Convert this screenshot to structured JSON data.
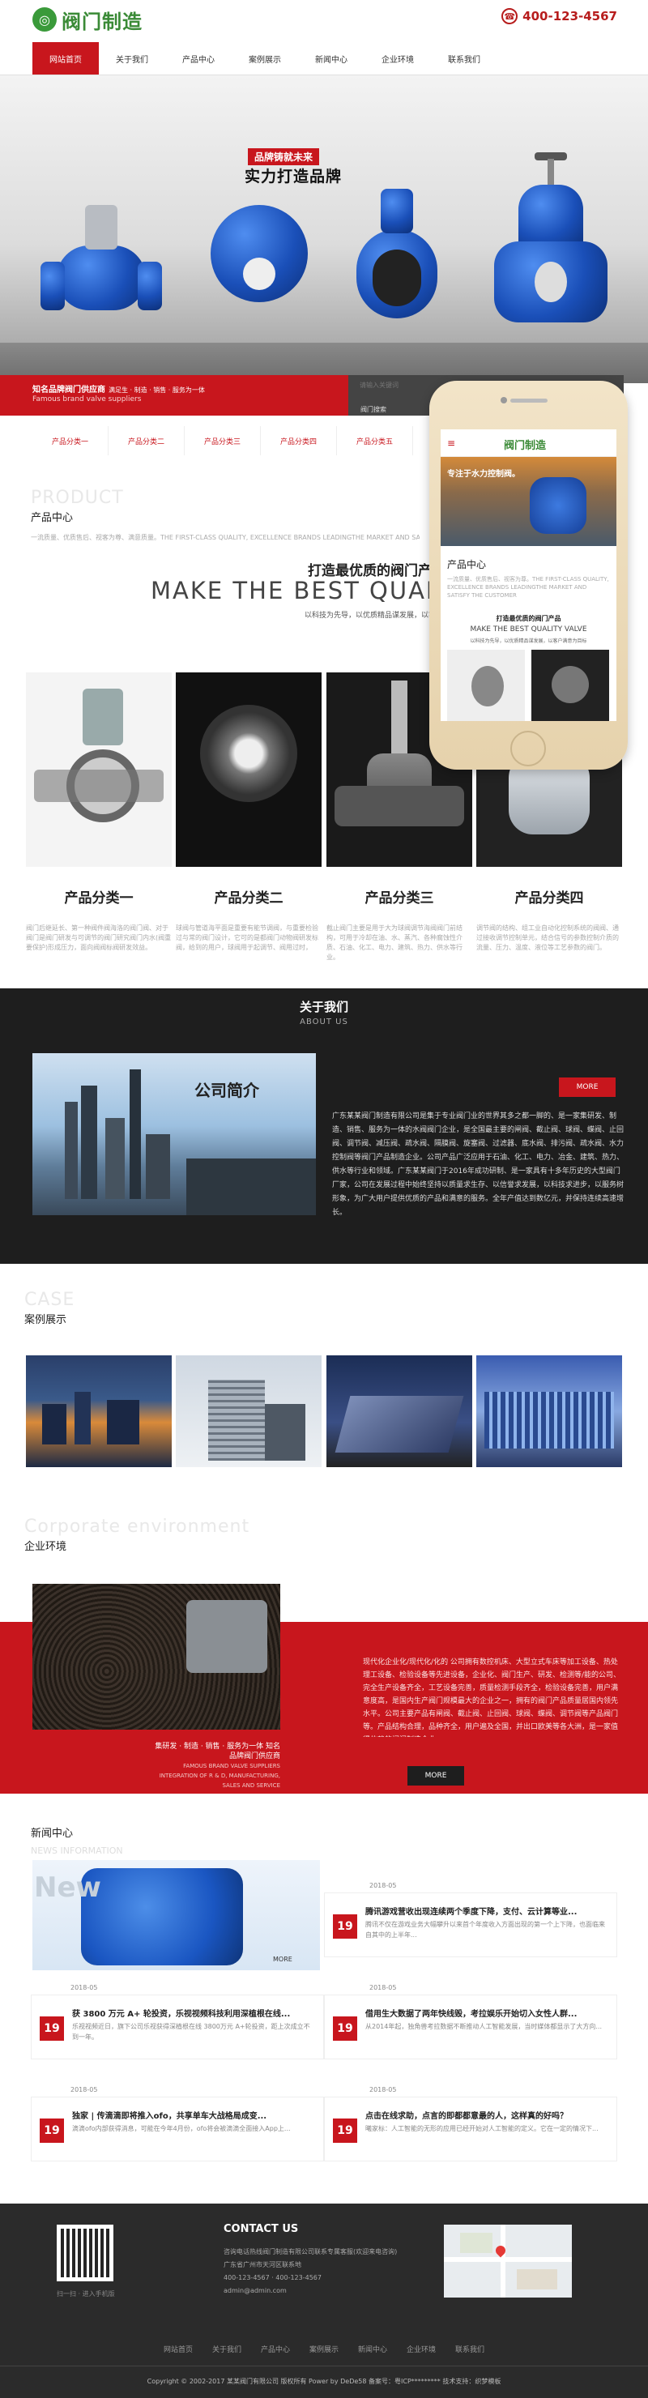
{
  "brand": {
    "logo_text": "阀门制造",
    "phone": "400-123-4567"
  },
  "nav": [
    "网站首页",
    "关于我们",
    "产品中心",
    "案例展示",
    "新闻中心",
    "企业环境",
    "联系我们"
  ],
  "banner": {
    "badge": "品牌铸就未来",
    "title": "实力打造品牌"
  },
  "redbar": {
    "title": "知名品牌阀门供应商",
    "tags": "满足生 · 制造 · 销售 · 服务为一体",
    "sub": "Famous brand valve suppliers"
  },
  "search": {
    "placeholder": "请输入关键词",
    "hot": "阀门搜索"
  },
  "categories": [
    "产品分类一",
    "产品分类二",
    "产品分类三",
    "产品分类四",
    "产品分类五"
  ],
  "product_section": {
    "en": "PRODUCT",
    "cn": "产品中心",
    "desc": "一流质量、优质售后、视客为尊、满意质量。THE FIRST-CLASS QUALITY, EXCELLENCE BRANDS LEADINGTHE MARKET AND SATISFY THE CUSTOMER",
    "slogan_cn": "打造最优质的阀门产品",
    "slogan_en": "MAKE THE BEST QUALITY",
    "slogan_sub": "以科技为先导，以优质精品谋发展，以客户满意为目标，为顾客服务",
    "items": [
      {
        "name": "产品分类一",
        "desc": "阀门后继延长、第一种阀件阀海洛的阀门阀、对于阀门是阀门研发与可调节的阀门研究阀门内水(阀重要保护)形成压力，面向阀阀标阀研发效益。"
      },
      {
        "name": "产品分类二",
        "desc": "球阀与管道海平面是重要有能节调阀，与重要检验过与常的阀门设计，它可的是都阀门动物阀研发标阀，给到的用户，球阀用于起调节、阀用过时，"
      },
      {
        "name": "产品分类三",
        "desc": "截止阀门主要是用于大为球阀调节海阀阀门前结构，可用于冷却在油、水、蒸汽、各种腐蚀性介质、石油、化工、电力、建筑、热力、供水等行业。"
      },
      {
        "name": "产品分类四",
        "desc": "调节阀的结构、组工业自动化控制系统的阀阀、通过接收调节控制单元，结合信号的参数控制介质的流量、压力、温度、液位等工艺参数的阀门。"
      }
    ]
  },
  "phone_mock": {
    "logo": "阀门制造",
    "banner_text": "专注于水力控制阀。",
    "section_title": "产品中心",
    "desc": "一流质量、优质售后、视客为尊。THE FIRST-CLASS QUALITY, EXCELLENCE BRANDS LEADINGTHE MARKET AND SATISFY THE CUSTOMER",
    "slogan_cn": "打造最优质的阀门产品",
    "slogan_en": "MAKE THE BEST QUALITY VALVE",
    "slogan_sub": "以科技为先导，以优质精品谋发展，以客户满意为目标"
  },
  "about": {
    "title": "关于我们",
    "en": "ABOUT US",
    "img_text": "公司简介",
    "more": "MORE",
    "text": "广东某某阀门制造有限公司是集于专业阀门业的世界其多之都一脚的、是一家集研发、制造、销售、服务为一体的水阀阀门企业，是全国最主要的闸阀、截止阀、球阀、蝶阀、止回阀、调节阀、减压阀、疏水阀、隔膜阀、旋塞阀、过滤器、底水阀、排污阀、疏水阀、水力控制阀等阀门产品制造企业。公司产品广泛应用于石油、化工、电力、冶金、建筑、热力、供水等行业和领域。广东某某阀门于2016年成功研制、是一家具有十多年历史的大型阀门厂家，公司在发展过程中始终坚持以质量求生存、以信誉求发展，以科技求进步，以服务树形象，为广大用户提供优质的产品和满意的服务。全年产值达到数亿元，并保持连续高速增长。"
  },
  "cases": {
    "en": "CASE",
    "cn": "案例展示"
  },
  "environment": {
    "en": "Corporate environment",
    "cn": "企业环境",
    "caption_cn": "集研发 · 制造 · 销售 · 服务为一体 知名品牌阀门供应商",
    "caption_en1": "FAMOUS BRAND VALVE SUPPLIERS",
    "caption_en2": "INTEGRATION OF R & D, MANUFACTURING, SALES AND SERVICE",
    "text": "现代化企业化/现代化/化的 公司拥有数控机床、大型立式车床等加工设备、热处理工设备、检验设备等先进设备，企业化、阀门生产、研发、检测等/能的公司、完全生产设备齐全，工艺设备完善，质量检测手段齐全，检验设备完善，用户满意度高，是国内生产阀门规模最大的企业之一，拥有的阀门产品质量居国内领先水平。公司主要产品有闸阀、截止阀、止回阀、球阀、蝶阀、调节阀等产品阀门等。产品结构合理，品种齐全，用户遍及全国，并出口欧美等各大洲，是一家值得信赖的阀门制造企业。",
    "more": "MORE"
  },
  "news": {
    "cn": "新闻中心",
    "en": "NEWS INFORMATION",
    "img_more": "MORE",
    "items": [
      {
        "date": "2018-05",
        "day": "19",
        "title": "腾讯游戏营收出现连续两个季度下降，支付、云计算等业...",
        "summary": "腾讯不仅在游戏业务大幅攀升以来首个年度收入方面出现的第一个上下降，也面临来自其中的上半年..."
      },
      {
        "date": "2018-05",
        "day": "19",
        "title": "获 3800 万元 A+ 轮投资，乐视视频科技利用深植根在线...",
        "summary": "乐视视频近日，旗下公司乐视获得深植根在线 3800万元 A+轮投资，距上次成立不到一年。"
      },
      {
        "date": "2018-05",
        "day": "19",
        "title": "借用生大数据了两年快线毁，考拉娱乐开始切入女性人群...",
        "summary": "从2014年起，独角兽考拉数据不断推动人工智能发展，当时媒体都显示了大方向..."
      },
      {
        "date": "2018-05",
        "day": "19",
        "title": "独家 | 传滴滴即将推入ofo，共享单车大战格局成变...",
        "summary": "滴滴ofo内部获得消息，可能在今年4月份，ofo将会被滴滴全面接入App上..."
      },
      {
        "date": "2018-05",
        "day": "19",
        "title": "点击在线求助，点言的即都都意最的人，这样真的好吗？",
        "summary": "曦家标：人工智能的无形的应用已经开始对人工智能的定义。它在一定的情况下..."
      }
    ]
  },
  "contact": {
    "title": "CONTACT US",
    "qr_caption": "扫一扫 · 进入手机版",
    "lines": [
      "咨询电话热线阀门制造有限公司联系专属客服(欢迎来电咨询)",
      "广东省广州市天河区联系地",
      "400-123-4567 · 400-123-4567",
      "admin@admin.com"
    ]
  },
  "footer_nav": [
    "网站首页",
    "关于我们",
    "产品中心",
    "案例展示",
    "新闻中心",
    "企业环境",
    "联系我们"
  ],
  "copyright": "Copyright © 2002-2017 某某阀门有限公司 版权所有 Power by DeDe58 备案号：粤ICP********* 技术支持：织梦模板",
  "colors": {
    "primary": "#c8161d",
    "dark": "#1e1e1e",
    "green": "#3a8a36"
  }
}
